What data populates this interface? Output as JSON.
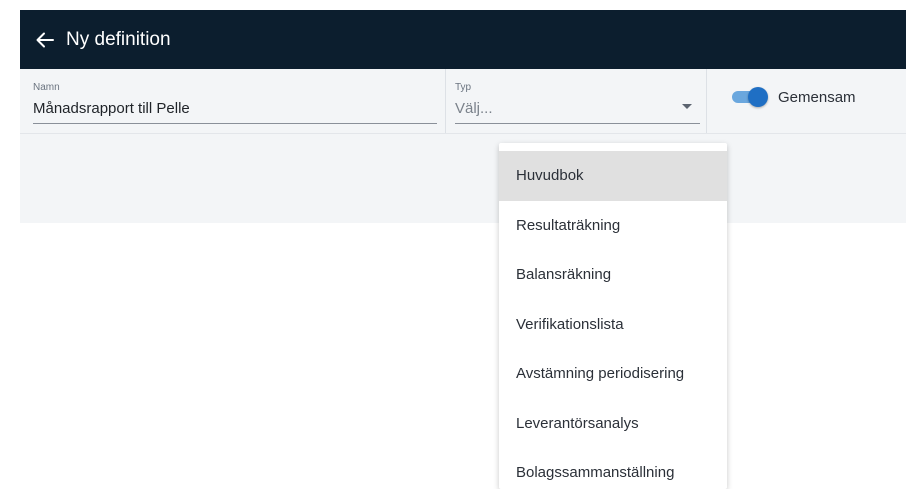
{
  "header": {
    "title": "Ny definition",
    "back_icon": "arrow-left-icon"
  },
  "form": {
    "name_label": "Namn",
    "name_value": "Månadsrapport till Pelle",
    "type_label": "Typ",
    "type_value": "Välj...",
    "shared_label": "Gemensam",
    "shared_on": true
  },
  "dropdown": {
    "items": [
      "Huvudbok",
      "Resultaträkning",
      "Balansräkning",
      "Verifikationslista",
      "Avstämning periodisering",
      "Leverantörsanalys",
      "Bolagssammanställning"
    ],
    "highlighted": "Huvudbok"
  },
  "colors": {
    "header_bg": "#0c1e2e",
    "panel_bg": "#f3f5f7",
    "accent": "#1f6fc4",
    "highlight": "#e0e0e0"
  }
}
